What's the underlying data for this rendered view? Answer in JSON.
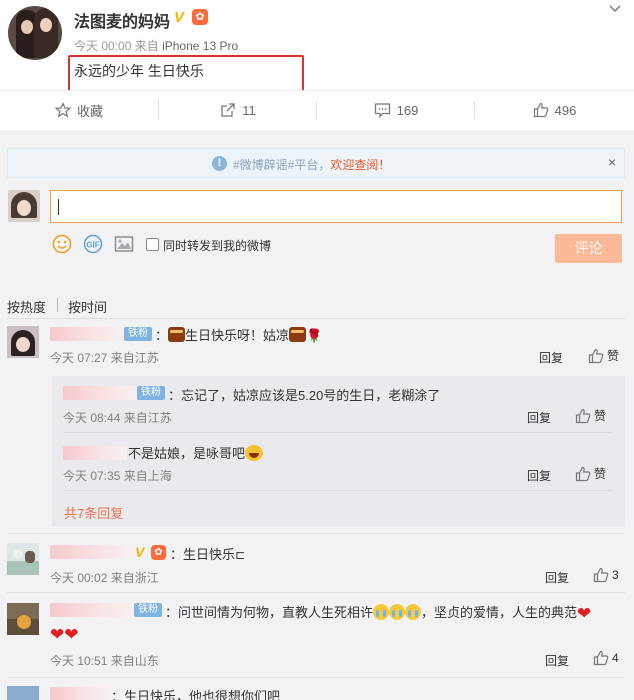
{
  "post": {
    "author": "法图麦的妈妈",
    "verified_mark": "V",
    "time": "今天 00:00",
    "source_prefix": "来自",
    "source": "iPhone 13 Pro",
    "text": "永远的少年 生日快乐"
  },
  "actions": {
    "favorite_label": "收藏",
    "share_count": "11",
    "comment_count": "169",
    "like_count": "496"
  },
  "notice": {
    "prefix": "#微博辟谣#平台，",
    "link": "欢迎查阅！",
    "close": "×"
  },
  "composer": {
    "forward_label": "同时转发到我的微博",
    "submit_label": "评论"
  },
  "sort": {
    "hot": "按热度",
    "time": "按时间"
  },
  "comments": [
    {
      "badge": "铁粉",
      "text_a": "：",
      "text_b": "生日快乐呀！姑凉",
      "meta": "今天 07:27 来自江苏",
      "reply": "回复",
      "like": "赞"
    },
    {
      "text": "：生日快乐",
      "meta": "今天 00:02 来自浙江",
      "reply": "回复",
      "like_count": "3"
    },
    {
      "badge": "铁粉",
      "text": "：问世间情为何物，直教人生死相许",
      "text_c": "，坚贞的爱情，人生的典范",
      "meta": "今天 10:51 来自山东",
      "reply": "回复",
      "like_count": "4"
    },
    {
      "text": "：生日快乐，他也很想你们吧"
    }
  ],
  "sub_replies": [
    {
      "badge": "铁粉",
      "text": "：忘记了，姑凉应该是5.20号的生日，老糊涂了",
      "meta": "今天 08:44 来自江苏",
      "reply": "回复",
      "like": "赞"
    },
    {
      "text": "不是姑娘，是咏哥吧",
      "meta": "今天 07:35 来自上海",
      "reply": "回复",
      "like": "赞"
    }
  ],
  "more_replies": "共7条回复",
  "colors": {
    "accent": "#eb7350",
    "highlight_box": "#e0302c",
    "fan_badge": "#7fb3e3"
  }
}
